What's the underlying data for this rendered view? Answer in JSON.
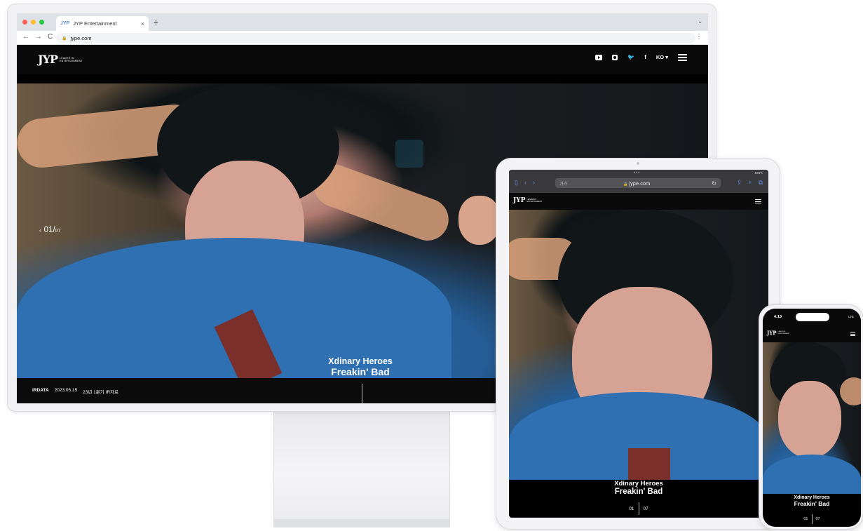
{
  "colors": {
    "mac_red": "#ff5f57",
    "mac_yellow": "#febc2e",
    "mac_green": "#28c840",
    "header_bg": "#0a0a0a",
    "hero_shirt_blue": "#2f70b3"
  },
  "desktop": {
    "browser": {
      "tab_favicon": "JYP",
      "tab_title": "JYP Entertainment",
      "tab_close": "×",
      "new_tab": "+",
      "tabs_dropdown": "⌄",
      "back": "←",
      "forward": "→",
      "reload": "C",
      "url": "jype.com",
      "menu": "⋮"
    },
    "header": {
      "logo_mark": "JYP",
      "logo_tag_line1": "LEADER IN",
      "logo_tag_line2": "ENTERTAINMENT",
      "social_icons": [
        "youtube-icon",
        "instagram-icon",
        "twitter-icon",
        "facebook-icon"
      ],
      "twitter_glyph": "🐦",
      "facebook_glyph": "f",
      "language": "KO ▾"
    },
    "slider": {
      "prev_arrow": "‹",
      "current": "01",
      "separator": "/",
      "total": "07"
    },
    "hero": {
      "artist": "Xdinary Heroes",
      "title": "Freakin' Bad"
    },
    "ir": {
      "label": "IRDATA",
      "date": "2023.05.15",
      "title": "23년 1분기 IR자료"
    }
  },
  "tablet": {
    "status_dots": "•••",
    "status_right": "100%",
    "tab_text": "가가",
    "lock": "🔒",
    "url": "jype.com",
    "reload": "↻",
    "left_icons": [
      "▯",
      "‹",
      "›"
    ],
    "right_icons": [
      "⇪",
      "+",
      "⧉"
    ],
    "logo_mark": "JYP",
    "logo_tag_line1": "LEADER IN",
    "logo_tag_line2": "ENTERTAINMENT",
    "hero_artist": "Xdinary Heroes",
    "hero_title": "Freakin' Bad",
    "pager_current": "01",
    "pager_total": "07"
  },
  "phone": {
    "time": "4:19",
    "status_right": "LTE",
    "logo_mark": "JYP",
    "logo_tag_line1": "LEADER IN",
    "logo_tag_line2": "ENTERTAINMENT",
    "hero_artist": "Xdinary Heroes",
    "hero_title": "Freakin' Bad",
    "pager_current": "01",
    "pager_total": "07"
  }
}
